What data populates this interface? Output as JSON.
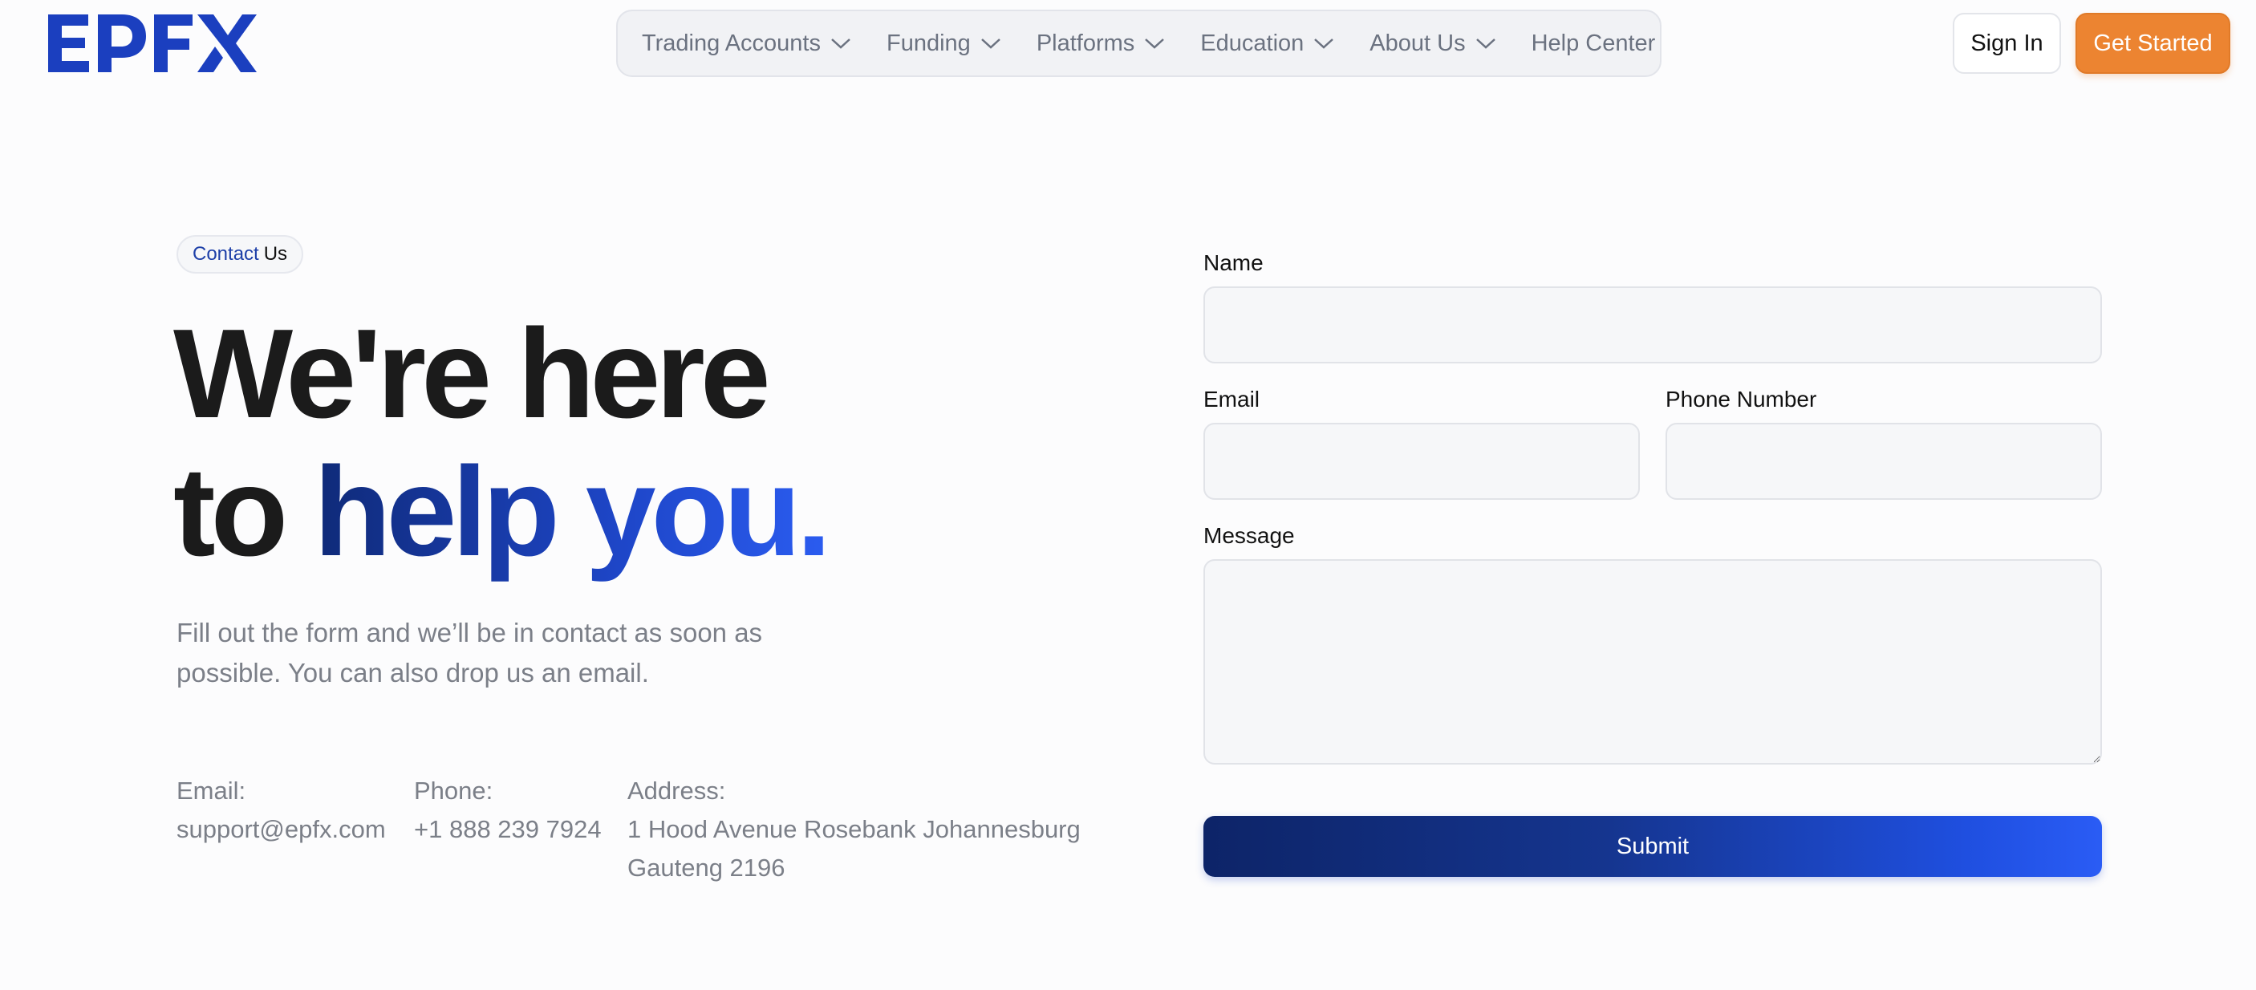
{
  "brand": {
    "logo_text": "EPFX",
    "logo_color": "#1b3fbf"
  },
  "nav": {
    "items": [
      {
        "label": "Trading Accounts",
        "icon": "chevron-down-icon"
      },
      {
        "label": "Funding",
        "icon": "chevron-down-icon"
      },
      {
        "label": "Platforms",
        "icon": "chevron-down-icon"
      },
      {
        "label": "Education",
        "icon": "chevron-down-icon"
      },
      {
        "label": "About Us",
        "icon": "chevron-down-icon"
      },
      {
        "label": "Help Center"
      }
    ]
  },
  "header_actions": {
    "sign_in": "Sign In",
    "get_started": "Get Started",
    "get_started_color": "#ec8431"
  },
  "hero": {
    "badge_part1": "Contact",
    "badge_part2": "Us",
    "line1": "We're here",
    "line2_plain": "to ",
    "line2_accent": "help you.",
    "description": "Fill out the form and we’ll be in contact as soon as possible. You can also drop us an email."
  },
  "contact": {
    "email_label": "Email:",
    "email_value": "support@epfx.com",
    "phone_label": "Phone:",
    "phone_value": "+1 888 239 7924",
    "address_label": "Address:",
    "address_line1": "1 Hood Avenue Rosebank Johannesburg",
    "address_line2": "Gauteng 2196"
  },
  "form": {
    "name_label": "Name",
    "name_value": "",
    "email_label": "Email",
    "email_value": "",
    "phone_label": "Phone Number",
    "phone_value": "",
    "message_label": "Message",
    "message_value": "",
    "submit_label": "Submit"
  }
}
